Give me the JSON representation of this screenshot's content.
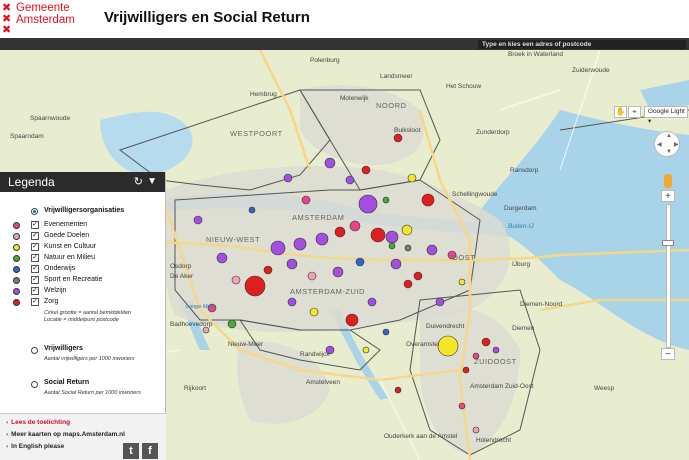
{
  "header": {
    "logo_text": "Gemeente Amsterdam",
    "logo_line1": "Gemeente",
    "logo_line2": "Amsterdam",
    "title": "Vrijwilligers en Social Return"
  },
  "search": {
    "placeholder": "Type en kies een adres of postcode"
  },
  "map_controls": {
    "basemap": "Google Light",
    "zoom_in": "+",
    "zoom_out": "−"
  },
  "legend": {
    "title": "Legenda",
    "layers": [
      {
        "title": "Vrijwilligersorganisaties",
        "selected": true,
        "note_line1": "Cirkel grootte = aantal bemiddelden",
        "note_line2": "Locatie = middelpunt postcode",
        "categories": [
          {
            "label": "Evenementen",
            "color": "#e8468c"
          },
          {
            "label": "Goede Doelen",
            "color": "#f0a0b8"
          },
          {
            "label": "Kunst en Cultuur",
            "color": "#f5e62a"
          },
          {
            "label": "Natuur en Milieu",
            "color": "#4aa83a"
          },
          {
            "label": "Onderwijs",
            "color": "#2f64c8"
          },
          {
            "label": "Sport en Recreatie",
            "color": "#7a7a7a"
          },
          {
            "label": "Welzijn",
            "color": "#a24fe0"
          },
          {
            "label": "Zorg",
            "color": "#e11e1e"
          }
        ]
      },
      {
        "title": "Vrijwilligers",
        "selected": false,
        "note": "Aantal vrijwilligers per 1000 inwoners"
      },
      {
        "title": "Social Return",
        "selected": false,
        "note": "Aantal Social Return per 1000 inwoners"
      }
    ],
    "links": [
      "Lees de toelichting",
      "Meer kaarten op maps.Amsterdam.nl",
      "In English please"
    ],
    "social": [
      "t",
      "f"
    ]
  },
  "map_labels": {
    "places": [
      "Landsmeer",
      "Zuiderwoude",
      "Het Schouw",
      "Broek in Waterland",
      "Zunderdorp",
      "Ransdorp",
      "Schellingwoude",
      "Durgerdam",
      "Buiten-IJ",
      "IJburg",
      "Diemen",
      "Duivendrecht",
      "Weesp",
      "Amstelveen",
      "Badhoevedorp",
      "Nieuw-Meer",
      "Randwijck",
      "Rijkoort",
      "Spaarnwoude",
      "Spaarndam",
      "Polenburg",
      "Hembrug",
      "Molenwijk",
      "Buiksloot",
      "Osdorp",
      "De Aker",
      "Overamstel",
      "Ouderkerk aan de Amstel",
      "Holendrecht",
      "Diemen-Noord",
      "Amsterdam Zuid-Oost"
    ],
    "districts": [
      "WESTPOORT",
      "AMSTERDAM",
      "NIEUW-WEST",
      "AMSTERDAM-ZUID",
      "OOST",
      "ZUIDOOST",
      "NOORD"
    ],
    "water": [
      "Lange Meer"
    ]
  },
  "colors": {
    "accent_red": "#e3101a",
    "topbar": "#333333",
    "map_bg": "#eef0d6",
    "water": "#a9d3e9",
    "urban": "#dcdad3"
  }
}
